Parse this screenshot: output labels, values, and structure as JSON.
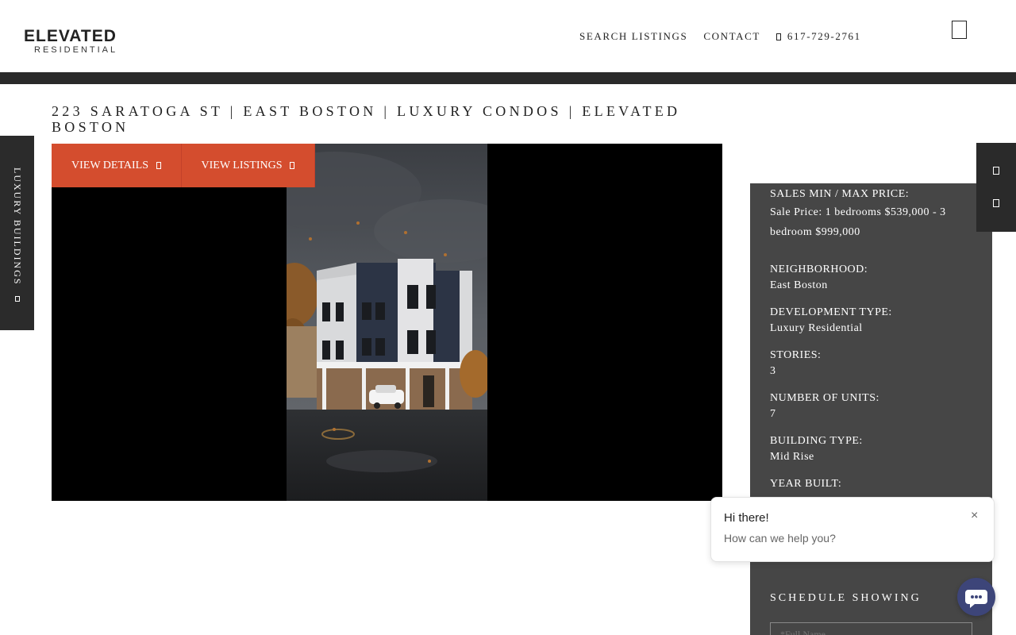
{
  "brand": {
    "name": "ELEVATED",
    "tagline": "RESIDENTIAL"
  },
  "nav": {
    "search_listings": "SEARCH LISTINGS",
    "contact": "CONTACT",
    "phone": "617-729-2761",
    "phone_icon": "phone-icon",
    "menu_icon": "menu-icon"
  },
  "page": {
    "title": "223 SARATOGA ST | EAST BOSTON | LUXURY CONDOS | ELEVATED BOSTON"
  },
  "side_tab": {
    "label": "LUXURY BUILDINGS",
    "icon": "arrow-icon"
  },
  "buttons": {
    "view_details": "VIEW DETAILS",
    "view_listings": "VIEW LISTINGS",
    "icon": "arrow-icon"
  },
  "info": {
    "sales_label": "SALES MIN / MAX PRICE:",
    "sales_value": "Sale Price: 1 bedrooms $539,000 - 3 bedroom $999,000",
    "neighborhood_label": "NEIGHBORHOOD:",
    "neighborhood_value": "East Boston",
    "development_label": "DEVELOPMENT TYPE:",
    "development_value": "Luxury Residential",
    "stories_label": "STORIES:",
    "stories_value": "3",
    "units_label": "NUMBER OF UNITS:",
    "units_value": "7",
    "building_label": "BUILDING TYPE:",
    "building_value": "Mid Rise",
    "year_label": "YEAR BUILT:",
    "schedule_title": "SCHEDULE SHOWING",
    "name_placeholder": "*Full Name"
  },
  "chat": {
    "greeting": "Hi there!",
    "prompt": "How can we help you?",
    "close": "×"
  },
  "colors": {
    "accent": "#d44d2e",
    "panel": "#464646",
    "dark": "#2a2a2a",
    "chat": "#3d4579"
  }
}
